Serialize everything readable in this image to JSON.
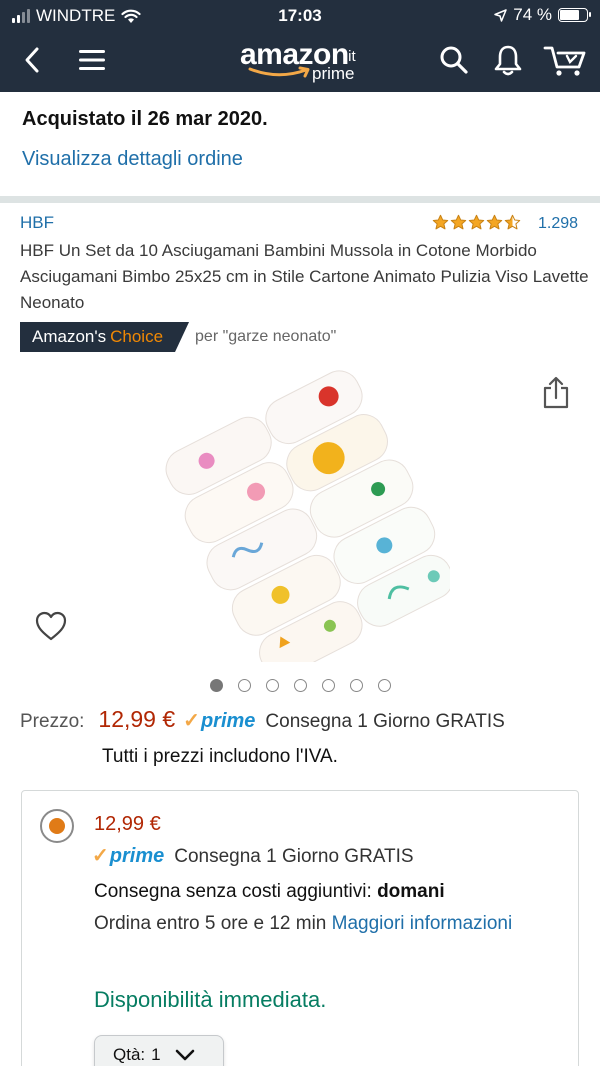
{
  "status_bar": {
    "carrier": "WINDTRE",
    "time": "17:03",
    "battery": "74 %",
    "battery_level": 0.74
  },
  "nav": {
    "logo_word": "amazon",
    "logo_tld": ".it",
    "logo_prime": "prime",
    "icons": [
      "back-icon",
      "menu-icon",
      "search-icon",
      "bell-icon",
      "cart-icon"
    ]
  },
  "order": {
    "purchased": "Acquistato il 26 mar 2020.",
    "details_link": "Visualizza dettagli ordine"
  },
  "product": {
    "brand": "HBF",
    "rating": 4.5,
    "review_count": "1.298",
    "title": "HBF Un Set da 10 Asciugamani Bambini Mussola in Cotone Morbido Asciugamani Bimbo 25x25 cm in Stile Cartone Animato Pulizia Viso Lavette Neonato",
    "choice_prefix": "Amazon's",
    "choice_word": "Choice",
    "choice_query": "per \"garze neonato\"",
    "image_count": 7,
    "active_image": 0
  },
  "price": {
    "label": "Prezzo:",
    "value": "12,99 €",
    "prime": "prime",
    "delivery": "Consegna 1 Giorno GRATIS",
    "vat_note": "Tutti i prezzi includono l'IVA."
  },
  "buybox": {
    "price": "12,99 €",
    "prime": "prime",
    "delivery": "Consegna 1 Giorno GRATIS",
    "free_delivery_prefix": "Consegna senza costi aggiuntivi:",
    "free_delivery_day": "domani",
    "order_within": "Ordina entro 5 ore e 12 min",
    "more_info": "Maggiori informazioni",
    "availability": "Disponibilità immediata.",
    "qty_label": "Qtà:",
    "qty_value": "1"
  },
  "colors": {
    "header_bg": "#232f3e",
    "link": "#1f6fa9",
    "price": "#b12704",
    "prime_blue": "#1a8fd0",
    "amazon_orange": "#f08804",
    "availability_green": "#067d62"
  }
}
